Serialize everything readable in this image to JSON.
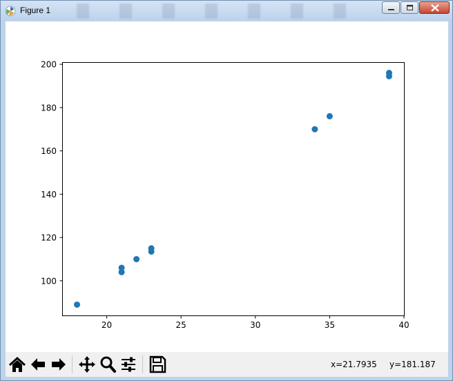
{
  "window": {
    "title": "Figure 1"
  },
  "toolbar": {
    "buttons": [
      {
        "name": "home-icon"
      },
      {
        "name": "back-arrow-icon"
      },
      {
        "name": "forward-arrow-icon"
      },
      {
        "name": "pan-icon"
      },
      {
        "name": "zoom-icon"
      },
      {
        "name": "configure-subplots-icon"
      },
      {
        "name": "save-icon"
      }
    ],
    "x_readout": "x=21.7935",
    "y_readout": "y=181.187"
  },
  "chart_data": {
    "type": "scatter",
    "title": "",
    "xlabel": "",
    "ylabel": "",
    "xlim": [
      17,
      40
    ],
    "ylim": [
      84,
      201
    ],
    "xticks": [
      20,
      25,
      30,
      35,
      40
    ],
    "yticks": [
      100,
      120,
      140,
      160,
      180,
      200
    ],
    "xtick_labels": [
      "20",
      "25",
      "30",
      "35",
      "40"
    ],
    "ytick_labels": [
      "100",
      "120",
      "140",
      "160",
      "180",
      "200"
    ],
    "grid": false,
    "marker_color": "#1f77b4",
    "points": [
      {
        "x": 18,
        "y": 89
      },
      {
        "x": 21,
        "y": 104
      },
      {
        "x": 21,
        "y": 106
      },
      {
        "x": 22,
        "y": 110
      },
      {
        "x": 23,
        "y": 113.5
      },
      {
        "x": 23,
        "y": 115
      },
      {
        "x": 34,
        "y": 170
      },
      {
        "x": 35,
        "y": 176
      },
      {
        "x": 39,
        "y": 194.5
      },
      {
        "x": 39,
        "y": 196
      }
    ]
  }
}
